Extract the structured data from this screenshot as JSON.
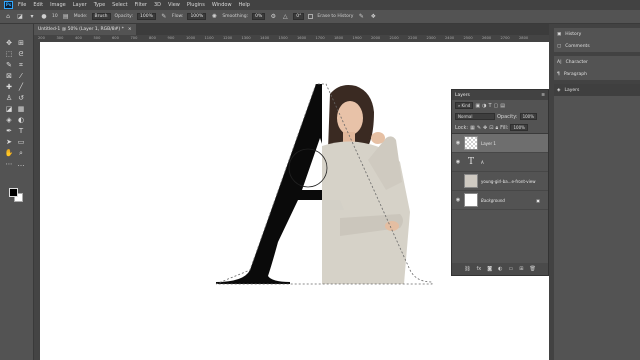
{
  "menubar": {
    "logo": "Ps",
    "items": [
      "File",
      "Edit",
      "Image",
      "Layer",
      "Type",
      "Select",
      "Filter",
      "3D",
      "View",
      "Plugins",
      "Window",
      "Help"
    ]
  },
  "options": {
    "brush_size": "10",
    "mode_label": "Mode:",
    "mode_value": "Brush",
    "opacity_label": "Opacity:",
    "opacity_value": "100%",
    "flow_label": "Flow:",
    "flow_value": "100%",
    "smoothing_label": "Smoothing:",
    "smoothing_value": "0%",
    "angle_value": "0°",
    "erase_history_label": "Erase to History"
  },
  "document": {
    "tab_title": "Untitled-1 @ 50% (Layer 1, RGB/8#) *",
    "close": "×"
  },
  "ruler": {
    "ticks": [
      "200",
      "300",
      "400",
      "500",
      "600",
      "700",
      "800",
      "900",
      "1000",
      "1100",
      "1200",
      "1300",
      "1400",
      "1500",
      "1600",
      "1700",
      "1800",
      "1900",
      "2000",
      "2100",
      "2200",
      "2300",
      "2400",
      "2500",
      "2600",
      "2700",
      "2800"
    ]
  },
  "canvas": {
    "letter": "A"
  },
  "layers_panel": {
    "title": "Layers",
    "kind_label": "Kind",
    "blend_mode": "Normal",
    "opacity_label": "Opacity:",
    "opacity_value": "100%",
    "lock_label": "Lock:",
    "fill_label": "Fill:",
    "fill_value": "100%",
    "layers": [
      {
        "name": "Layer 1",
        "type": "pixel",
        "visible": true,
        "selected": true
      },
      {
        "name": "A",
        "type": "text",
        "visible": true,
        "selected": false
      },
      {
        "name": "young-girl-ba...e-front-view",
        "type": "image",
        "visible": false,
        "selected": false
      },
      {
        "name": "Background",
        "type": "background",
        "visible": true,
        "selected": false,
        "locked": true
      }
    ]
  },
  "right_panels": {
    "group1": [
      "History",
      "Comments"
    ],
    "group2": [
      "Character",
      "Paragraph"
    ],
    "group3": [
      "Layers"
    ]
  },
  "colors": {
    "ui_dark": "#424242",
    "ui_mid": "#535353",
    "accent_ps": "#31a8ff",
    "foreground": "#000000",
    "background": "#ffffff"
  }
}
